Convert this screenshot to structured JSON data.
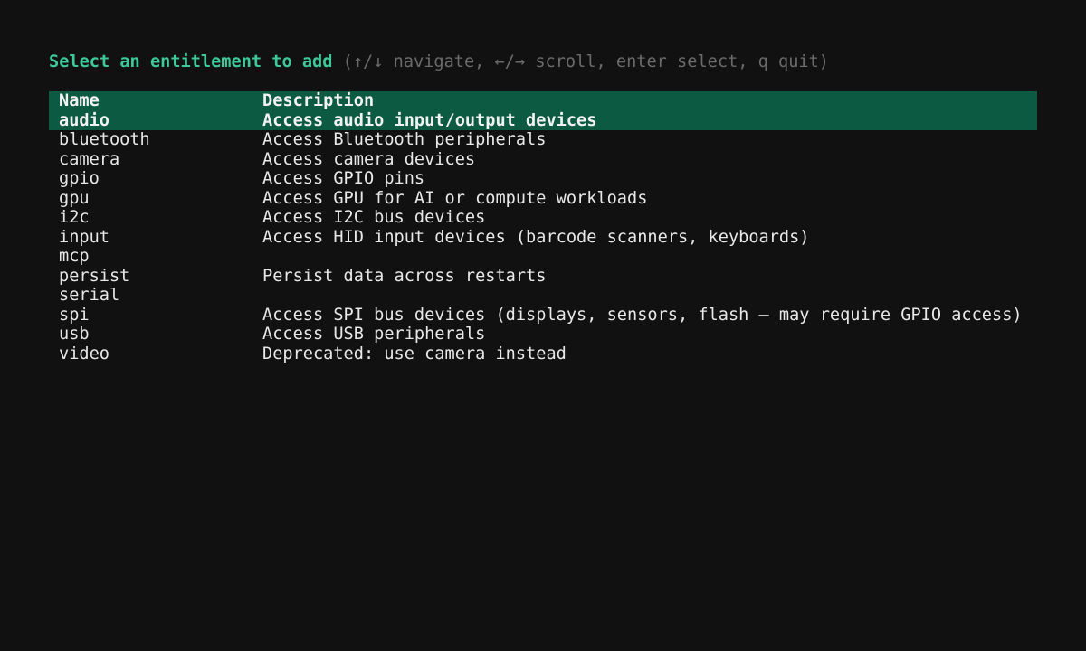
{
  "prompt": {
    "title": "Select an entitlement to add",
    "hint": " (↑/↓ navigate, ←/→ scroll, enter select, q quit)"
  },
  "table": {
    "columns": [
      "Name",
      "Description"
    ],
    "selected_index": 0,
    "rows": [
      {
        "name": "audio",
        "description": "Access audio input/output devices"
      },
      {
        "name": "bluetooth",
        "description": "Access Bluetooth peripherals"
      },
      {
        "name": "camera",
        "description": "Access camera devices"
      },
      {
        "name": "gpio",
        "description": "Access GPIO pins"
      },
      {
        "name": "gpu",
        "description": "Access GPU for AI or compute workloads"
      },
      {
        "name": "i2c",
        "description": "Access I2C bus devices"
      },
      {
        "name": "input",
        "description": "Access HID input devices (barcode scanners, keyboards)"
      },
      {
        "name": "mcp",
        "description": ""
      },
      {
        "name": "persist",
        "description": "Persist data across restarts"
      },
      {
        "name": "serial",
        "description": ""
      },
      {
        "name": "spi",
        "description": "Access SPI bus devices (displays, sensors, flash — may require GPIO access)"
      },
      {
        "name": "usb",
        "description": "Access USB peripherals"
      },
      {
        "name": "video",
        "description": "Deprecated: use camera instead"
      }
    ]
  },
  "colors": {
    "background": "#111111",
    "accent": "#3ec99a",
    "hint": "#6b6b6b",
    "selection": "#0c5a41",
    "text": "#e8e8e8"
  }
}
